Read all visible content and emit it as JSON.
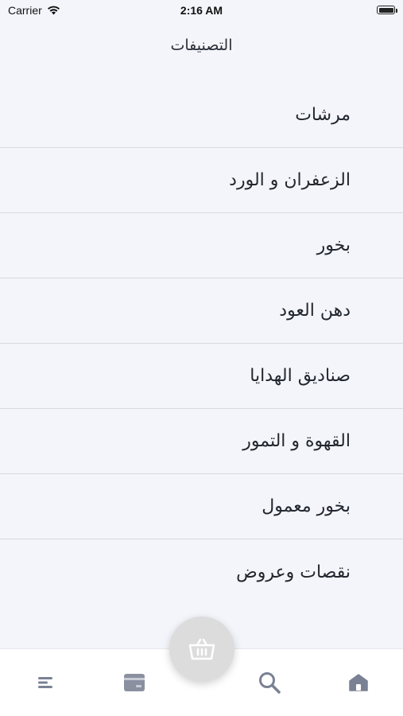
{
  "status_bar": {
    "carrier": "Carrier",
    "time": "2:16 AM"
  },
  "header": {
    "title": "التصنيفات"
  },
  "categories": [
    {
      "label": "مرشات"
    },
    {
      "label": "الزعفران و الورد"
    },
    {
      "label": "بخور"
    },
    {
      "label": "دهن العود"
    },
    {
      "label": "صناديق الهدايا"
    },
    {
      "label": "القهوة و التمور"
    },
    {
      "label": "بخور معمول"
    },
    {
      "label": "نقصات وعروض"
    }
  ],
  "tab_bar": {
    "items": [
      {
        "icon": "menu-icon"
      },
      {
        "icon": "card-icon"
      },
      {
        "icon": "search-icon"
      },
      {
        "icon": "home-icon"
      }
    ],
    "cart_icon": "basket-icon",
    "icon_color": "#7a8194",
    "fab_color": "#dcdcdc"
  }
}
